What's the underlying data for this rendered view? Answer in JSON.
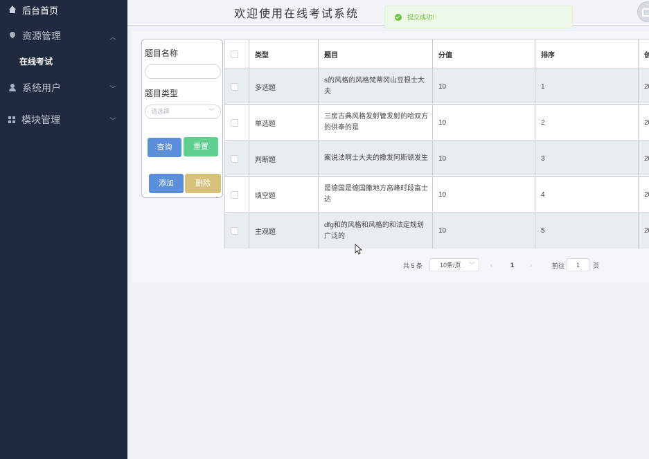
{
  "sidebar": {
    "home": "后台首页",
    "resources": "资源管理",
    "online_exam": "在线考试",
    "system_users": "系统用户",
    "modules": "模块管理"
  },
  "header": {
    "title": "欢迎使用在线考试系统",
    "toast": "提交成功!"
  },
  "search": {
    "name_label": "题目名称",
    "name_value": "",
    "type_label": "题目类型",
    "type_placeholder": "请选择",
    "query_button": "查询",
    "reset_button": "重置",
    "add_button": "添加",
    "delete_button": "删除"
  },
  "table": {
    "columns": [
      "类型",
      "题目",
      "分值",
      "排序",
      "创"
    ],
    "rows": [
      {
        "type": "多选题",
        "question": "s的风格的风格梵蒂冈山豆根士大夫",
        "score": "10",
        "sort": "1",
        "created": "20"
      },
      {
        "type": "单选题",
        "question": "三房古典风格发射管发射的哈双方的供奉的是",
        "score": "10",
        "sort": "2",
        "created": "20"
      },
      {
        "type": "判断题",
        "question": "案说法啊士大夫的撒发阿斯顿发生",
        "score": "10",
        "sort": "3",
        "created": "20"
      },
      {
        "type": "填空题",
        "question": "是德国是德国撒地方高峰时段富士达",
        "score": "10",
        "sort": "4",
        "created": "20"
      },
      {
        "type": "主观题",
        "question": "dfg和的风格和风格的和法定规划广泛的",
        "score": "10",
        "sort": "5",
        "created": "20"
      }
    ]
  },
  "pager": {
    "total": "共 5 条",
    "page_size": "10条/页",
    "current": "1",
    "goto_label": "前往",
    "goto_value": "1",
    "page_suffix": "页"
  },
  "colors": {
    "sidebar_bg": "#1f2a3f",
    "primary": "#5b8fdc",
    "success": "#67c23a",
    "warning": "#d8c27a"
  }
}
